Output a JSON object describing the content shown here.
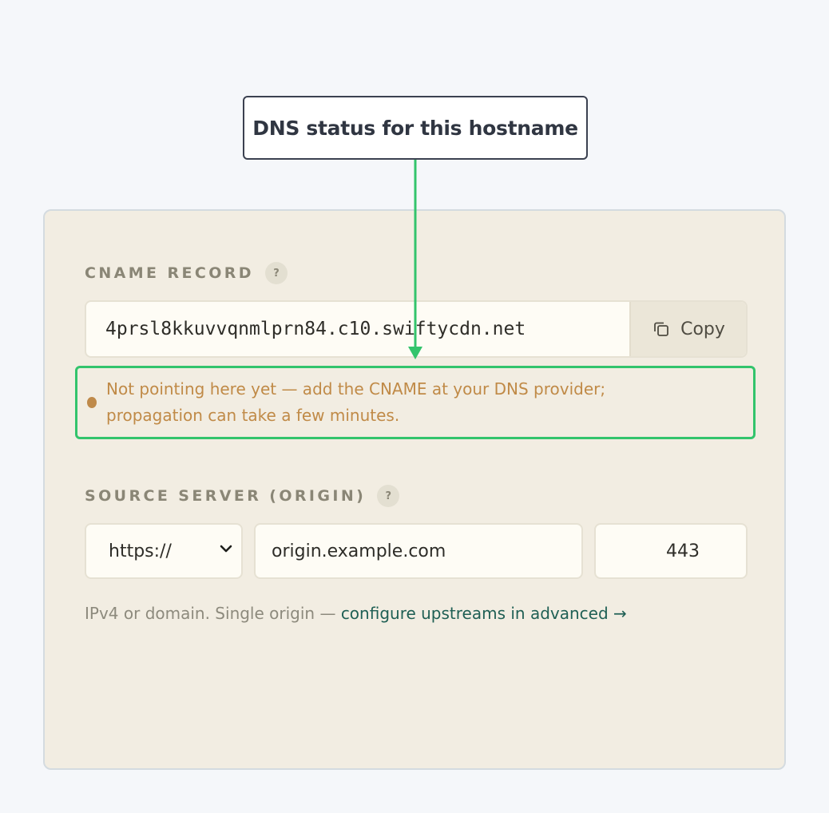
{
  "callout": {
    "text": "DNS status for this hostname"
  },
  "cname": {
    "label": "CNAME RECORD",
    "help": "?",
    "value": "4prsl8kkuvvqnmlprn84.c10.swiftycdn.net",
    "copy_label": "Copy"
  },
  "status": {
    "line1": "Not pointing here yet — add the CNAME at your DNS provider;",
    "line2": "propagation can take a few minutes.",
    "color": "#c08a47"
  },
  "origin": {
    "label": "SOURCE SERVER (ORIGIN)",
    "help": "?",
    "scheme": "https://",
    "host": "origin.example.com",
    "port": "443",
    "hint_text": "IPv4 or domain. Single origin — ",
    "hint_link": "configure upstreams in advanced →"
  },
  "colors": {
    "accent_green": "#33c46c",
    "link": "#1f5f54",
    "card_bg": "#f2ede2"
  }
}
